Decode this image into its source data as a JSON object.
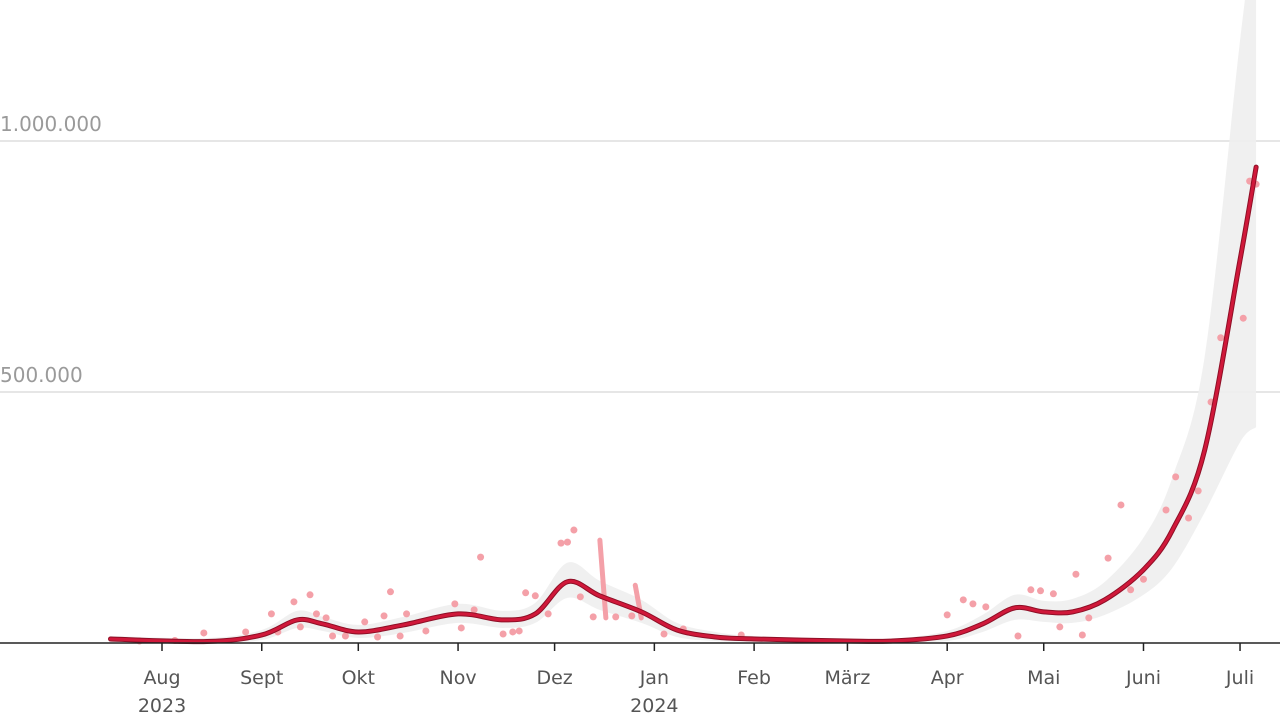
{
  "chart_data": {
    "type": "line",
    "title": "",
    "xlabel": "",
    "ylabel": "",
    "ylim": [
      0,
      1280000
    ],
    "grid": true,
    "y_ticks": [
      {
        "value": 500000,
        "label": "500.000"
      },
      {
        "value": 1000000,
        "label": "1.000.000"
      }
    ],
    "x_ticks": [
      {
        "date": "2023-08-01",
        "label": "Aug",
        "year": "2023"
      },
      {
        "date": "2023-09-01",
        "label": "Sept",
        "year": ""
      },
      {
        "date": "2023-10-01",
        "label": "Okt",
        "year": ""
      },
      {
        "date": "2023-11-01",
        "label": "Nov",
        "year": ""
      },
      {
        "date": "2023-12-01",
        "label": "Dez",
        "year": ""
      },
      {
        "date": "2024-01-01",
        "label": "Jan",
        "year": "2024"
      },
      {
        "date": "2024-02-01",
        "label": "Feb",
        "year": ""
      },
      {
        "date": "2024-03-01",
        "label": "März",
        "year": ""
      },
      {
        "date": "2024-04-01",
        "label": "Apr",
        "year": ""
      },
      {
        "date": "2024-05-01",
        "label": "Mai",
        "year": ""
      },
      {
        "date": "2024-06-01",
        "label": "Juni",
        "year": ""
      },
      {
        "date": "2024-07-01",
        "label": "Juli",
        "year": ""
      }
    ],
    "colors": {
      "line": "#d0183a",
      "points": "#f4a0a8",
      "band": "#eeeeee",
      "grid": "#dddddd",
      "axis": "#222222"
    },
    "trend": [
      [
        "2023-07-16",
        8000,
        2000,
        14000
      ],
      [
        "2023-08-15",
        3000,
        0,
        10000
      ],
      [
        "2023-09-01",
        16000,
        6000,
        26000
      ],
      [
        "2023-09-12",
        46000,
        30000,
        64000
      ],
      [
        "2023-09-20",
        38000,
        24000,
        52000
      ],
      [
        "2023-10-01",
        22000,
        10000,
        36000
      ],
      [
        "2023-10-15",
        36000,
        20000,
        52000
      ],
      [
        "2023-11-01",
        58000,
        40000,
        78000
      ],
      [
        "2023-11-15",
        46000,
        30000,
        64000
      ],
      [
        "2023-11-25",
        58000,
        40000,
        80000
      ],
      [
        "2023-12-05",
        122000,
        90000,
        160000
      ],
      [
        "2023-12-15",
        94000,
        66000,
        124000
      ],
      [
        "2023-12-28",
        62000,
        40000,
        86000
      ],
      [
        "2024-01-08",
        26000,
        12000,
        40000
      ],
      [
        "2024-01-20",
        12000,
        4000,
        22000
      ],
      [
        "2024-02-01",
        8000,
        2000,
        14000
      ],
      [
        "2024-03-01",
        4000,
        0,
        8000
      ],
      [
        "2024-03-15",
        4000,
        0,
        8000
      ],
      [
        "2024-04-01",
        14000,
        4000,
        24000
      ],
      [
        "2024-04-12",
        38000,
        22000,
        56000
      ],
      [
        "2024-04-22",
        70000,
        46000,
        96000
      ],
      [
        "2024-05-01",
        62000,
        42000,
        84000
      ],
      [
        "2024-05-10",
        62000,
        40000,
        88000
      ],
      [
        "2024-05-20",
        86000,
        56000,
        122000
      ],
      [
        "2024-06-01",
        146000,
        96000,
        210000
      ],
      [
        "2024-06-10",
        225000,
        150000,
        330000
      ],
      [
        "2024-06-20",
        384000,
        260000,
        570000
      ],
      [
        "2024-07-01",
        763000,
        400000,
        1200000
      ],
      [
        "2024-07-06",
        948000,
        430000,
        1450000
      ]
    ],
    "points": [
      [
        "2023-07-25",
        4000
      ],
      [
        "2023-08-05",
        5000
      ],
      [
        "2023-08-14",
        20000
      ],
      [
        "2023-08-27",
        22000
      ],
      [
        "2023-09-04",
        58000
      ],
      [
        "2023-09-06",
        22000
      ],
      [
        "2023-09-11",
        82000
      ],
      [
        "2023-09-13",
        32000
      ],
      [
        "2023-09-16",
        96000
      ],
      [
        "2023-09-18",
        58000
      ],
      [
        "2023-09-21",
        50000
      ],
      [
        "2023-09-23",
        14000
      ],
      [
        "2023-09-27",
        14000
      ],
      [
        "2023-10-03",
        42000
      ],
      [
        "2023-10-07",
        12000
      ],
      [
        "2023-10-09",
        54000
      ],
      [
        "2023-10-11",
        102000
      ],
      [
        "2023-10-14",
        14000
      ],
      [
        "2023-10-16",
        58000
      ],
      [
        "2023-10-22",
        24000
      ],
      [
        "2023-10-31",
        78000
      ],
      [
        "2023-11-02",
        30000
      ],
      [
        "2023-11-06",
        66000
      ],
      [
        "2023-11-08",
        171000
      ],
      [
        "2023-11-15",
        18000
      ],
      [
        "2023-11-18",
        22000
      ],
      [
        "2023-11-20",
        24000
      ],
      [
        "2023-11-22",
        100000
      ],
      [
        "2023-11-25",
        94000
      ],
      [
        "2023-11-29",
        58000
      ],
      [
        "2023-12-03",
        199000
      ],
      [
        "2023-12-05",
        201000
      ],
      [
        "2023-12-07",
        225000
      ],
      [
        "2023-12-09",
        92000
      ],
      [
        "2023-12-13",
        52000
      ],
      [
        "2023-12-20",
        52000
      ],
      [
        "2023-12-25",
        54000
      ],
      [
        "2024-01-04",
        18000
      ],
      [
        "2024-01-10",
        28000
      ],
      [
        "2024-01-28",
        16000
      ],
      [
        "2024-04-01",
        56000
      ],
      [
        "2024-04-06",
        86000
      ],
      [
        "2024-04-09",
        78000
      ],
      [
        "2024-04-13",
        72000
      ],
      [
        "2024-04-23",
        14000
      ],
      [
        "2024-04-27",
        106000
      ],
      [
        "2024-04-30",
        104000
      ],
      [
        "2024-05-04",
        98000
      ],
      [
        "2024-05-06",
        32000
      ],
      [
        "2024-05-11",
        137000
      ],
      [
        "2024-05-13",
        16000
      ],
      [
        "2024-05-15",
        50000
      ],
      [
        "2024-05-21",
        169000
      ],
      [
        "2024-05-25",
        275000
      ],
      [
        "2024-05-28",
        106000
      ],
      [
        "2024-06-01",
        127000
      ],
      [
        "2024-06-08",
        265000
      ],
      [
        "2024-06-11",
        331000
      ],
      [
        "2024-06-15",
        249000
      ],
      [
        "2024-06-18",
        303000
      ],
      [
        "2024-06-22",
        480000
      ],
      [
        "2024-06-25",
        608000
      ],
      [
        "2024-07-02",
        647000
      ],
      [
        "2024-07-04",
        920000
      ],
      [
        "2024-07-06",
        914000
      ]
    ],
    "ranges": [
      [
        "2023-12-16",
        50000,
        205000
      ],
      [
        "2023-12-27",
        50000,
        115000
      ]
    ]
  }
}
